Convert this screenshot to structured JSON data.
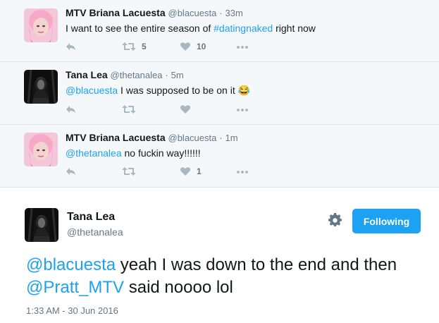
{
  "replies": [
    {
      "name": "MTV Briana Lacuesta",
      "handle": "@blacuesta",
      "dot": "·",
      "time": "33m",
      "text_prefix": "I want to see the entire season of ",
      "hashtag": "#datingnaked",
      "text_suffix": " right now",
      "retweets": "5",
      "likes": "10"
    },
    {
      "name": "Tana Lea",
      "handle": "@thetanalea",
      "dot": "·",
      "time": "5m",
      "mention": "@blacuesta",
      "text": " I was supposed to be on it 😂",
      "retweets": "",
      "likes": ""
    },
    {
      "name": "MTV Briana Lacuesta",
      "handle": "@blacuesta",
      "dot": "·",
      "time": "1m",
      "mention": "@thetanalea",
      "text": " no fuckin way!!!!!!",
      "retweets": "",
      "likes": "1"
    }
  ],
  "main_tweet": {
    "name": "Tana Lea",
    "handle": "@thetanalea",
    "follow_label": "Following",
    "mention1": "@blacuesta",
    "text1": " yeah I was down to the end and then ",
    "mention2": "@Pratt_MTV",
    "text2": " said noooo lol",
    "timestamp": "1:33 AM - 30 Jun 2016"
  },
  "colors": {
    "link": "#1da1f2",
    "reply_bg": "#f5f8fa",
    "muted": "#657786",
    "button": "#1da1f2"
  },
  "icons": [
    "reply-icon",
    "retweet-icon",
    "like-icon",
    "more-icon",
    "gear-icon"
  ]
}
